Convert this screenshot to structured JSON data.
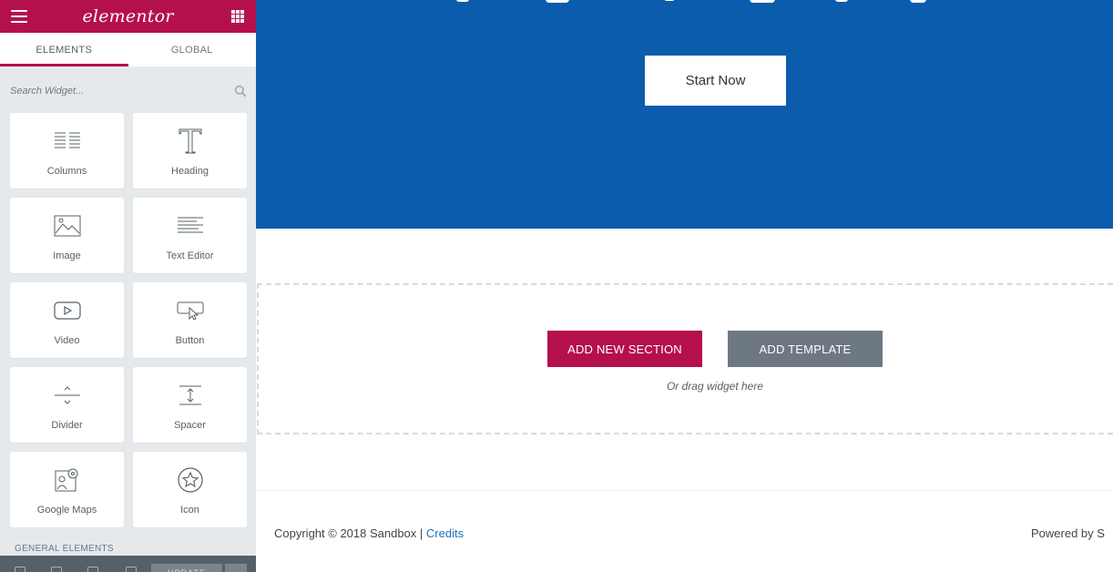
{
  "app": {
    "logo": "elementor",
    "brand_color": "#b5104e"
  },
  "sidebar": {
    "tabs": [
      {
        "label": "ELEMENTS"
      },
      {
        "label": "GLOBAL"
      }
    ],
    "search": {
      "placeholder": "Search Widget..."
    },
    "widgets": [
      {
        "label": "Columns",
        "icon": "columns-icon"
      },
      {
        "label": "Heading",
        "icon": "heading-icon"
      },
      {
        "label": "Image",
        "icon": "image-icon"
      },
      {
        "label": "Text Editor",
        "icon": "text-editor-icon"
      },
      {
        "label": "Video",
        "icon": "video-icon"
      },
      {
        "label": "Button",
        "icon": "button-icon"
      },
      {
        "label": "Divider",
        "icon": "divider-icon"
      },
      {
        "label": "Spacer",
        "icon": "spacer-icon"
      },
      {
        "label": "Google Maps",
        "icon": "google-maps-icon"
      },
      {
        "label": "Icon",
        "icon": "star-icon"
      }
    ],
    "section_title": "GENERAL ELEMENTS",
    "footer": {
      "update_label": "UPDATE"
    }
  },
  "canvas": {
    "hero": {
      "background": "#0b5cad",
      "button_label": "Start Now"
    },
    "dropzone": {
      "add_section_label": "ADD NEW SECTION",
      "add_template_label": "ADD TEMPLATE",
      "hint": "Or drag widget here"
    },
    "footer": {
      "copyright": "Copyright © 2018 Sandbox | ",
      "credits_link": "Credits",
      "powered": "Powered by S"
    }
  }
}
